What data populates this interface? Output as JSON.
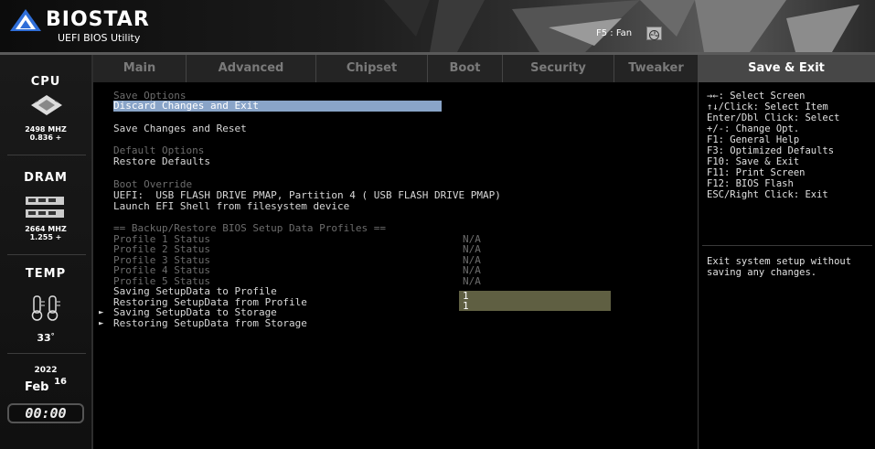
{
  "header": {
    "brand": "BIOSTAR",
    "subtitle": "UEFI BIOS Utility",
    "fan_hint": "F5 : Fan"
  },
  "sidebar": {
    "cpu_title": "CPU",
    "cpu_freq": "2498 MHZ",
    "cpu_volt": "0.836 +",
    "dram_title": "DRAM",
    "dram_freq": "2664 MHZ",
    "dram_volt": "1.255 +",
    "temp_title": "TEMP",
    "temp_value": "33",
    "temp_unit": "°",
    "year": "2022",
    "month": "Feb",
    "day": "16",
    "time": "00:00"
  },
  "tabs": [
    "Main",
    "Advanced",
    "Chipset",
    "Boot",
    "Security",
    "Tweaker",
    "Save & Exit"
  ],
  "main": {
    "save_options_header": "Save Options",
    "discard_and_exit": "Discard Changes and Exit",
    "save_and_reset": "Save Changes and Reset",
    "default_options_header": "Default Options",
    "restore_defaults": "Restore Defaults",
    "boot_override_header": "Boot Override",
    "boot_uefi": "UEFI:  USB FLASH DRIVE PMAP, Partition 4 ( USB FLASH DRIVE PMAP)",
    "launch_efi_shell": "Launch EFI Shell from filesystem device",
    "profiles_header": "== Backup/Restore BIOS Setup Data Profiles ==",
    "profiles": [
      {
        "label": "Profile 1 Status",
        "value": "N/A"
      },
      {
        "label": "Profile 2 Status",
        "value": "N/A"
      },
      {
        "label": "Profile 3 Status",
        "value": "N/A"
      },
      {
        "label": "Profile 4 Status",
        "value": "N/A"
      },
      {
        "label": "Profile 5 Status",
        "value": "N/A"
      }
    ],
    "saving_to_profile": {
      "label": "Saving SetupData to Profile",
      "value": "1"
    },
    "restoring_from_profile": {
      "label": "Restoring SetupData from Profile",
      "value": "1"
    },
    "saving_to_storage": "Saving SetupData to Storage",
    "restoring_from_storage": "Restoring SetupData from Storage",
    "submenu_arrow": "►"
  },
  "help": {
    "keys": [
      "→←: Select Screen",
      "↑↓/Click: Select Item",
      "Enter/Dbl Click: Select",
      "+/-: Change Opt.",
      "F1: General Help",
      "F3: Optimized Defaults",
      "F10: Save & Exit",
      "F11: Print Screen",
      "F12: BIOS Flash",
      "ESC/Right Click: Exit"
    ],
    "description": "Exit system setup without saving any changes."
  },
  "colors": {
    "selection": "#89a4c8",
    "value_box": "#5f5f42",
    "active_tab": "#474747",
    "dim_text": "#6c6c6c"
  },
  "icons": [
    "biostar-logo-icon",
    "fan-icon",
    "cpu-chip-icon",
    "dram-stick-icon",
    "thermometer-icon"
  ]
}
